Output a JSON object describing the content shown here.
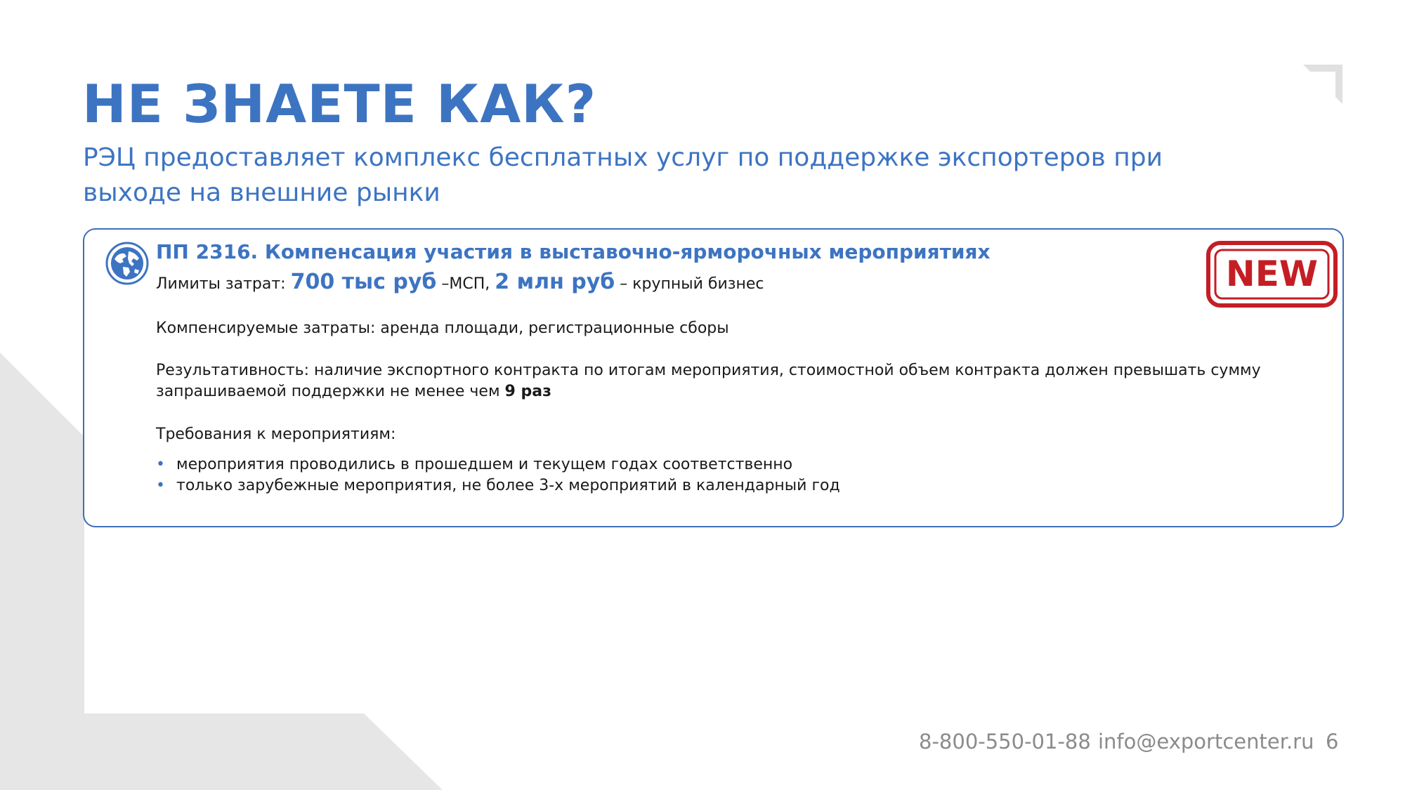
{
  "slide": {
    "title": "НЕ ЗНАЕТЕ КАК?",
    "subtitle": "РЭЦ предоставляет комплекс бесплатных услуг по поддержке экспортеров при выходе на внешние рынки"
  },
  "card": {
    "icon": "globe-icon",
    "title": "ПП 2316. Компенсация участия в выставочно-ярморочных мероприятиях",
    "stamp_text": "NEW",
    "stamp_color": "#c41e24",
    "limits": {
      "label": "Лимиты затрат: ",
      "sme_amount": "700 тыс руб",
      "sme_label": " –МСП, ",
      "large_amount": "2 млн руб",
      "large_label": " – крупный бизнес"
    },
    "compensated_costs": "Компенсируемые затраты: аренда площади, регистрационные сборы",
    "effectiveness": {
      "text": "Результативность: наличие экспортного контракта по итогам мероприятия, стоимостной объем контракта должен превышать сумму запрашиваемой поддержки не менее чем ",
      "highlight": "9 раз"
    },
    "requirements": {
      "heading": "Требования к мероприятиям:",
      "items": [
        "мероприятия проводились в прошедшем и текущем годах соответственно",
        "только зарубежные мероприятия, не более 3-х мероприятий в календарный год"
      ]
    }
  },
  "footer": {
    "phone": "8-800-550-01-88",
    "email": "info@exportcenter.ru",
    "page_number": "6"
  },
  "colors": {
    "accent": "#3d74c2",
    "card_border": "#3d6fb5",
    "background_shape": "#e6e6e6",
    "stamp": "#c41e24",
    "footer_text": "#8b8b8b"
  }
}
